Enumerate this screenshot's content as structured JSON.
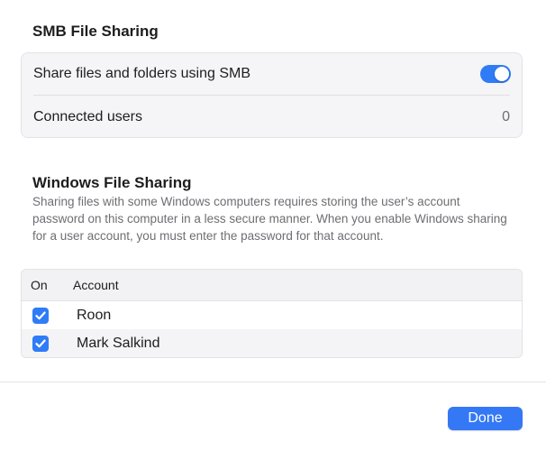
{
  "smb": {
    "title": "SMB File Sharing",
    "share_label": "Share files and folders using SMB",
    "share_enabled": true,
    "connected_label": "Connected users",
    "connected_value": "0"
  },
  "windows": {
    "title": "Windows File Sharing",
    "description": "Sharing files with some Windows computers requires storing the user’s account password on this computer in a less secure manner. When you enable Windows sharing for a user account, you must enter the password for that account.",
    "columns": {
      "on": "On",
      "account": "Account"
    },
    "rows": [
      {
        "checked": true,
        "account": "Roon"
      },
      {
        "checked": true,
        "account": "Mark Salkind"
      }
    ]
  },
  "footer": {
    "done_label": "Done"
  },
  "colors": {
    "accent": "#2f7cf6",
    "background": "#ffffff",
    "group_bg": "#f5f5f7"
  }
}
